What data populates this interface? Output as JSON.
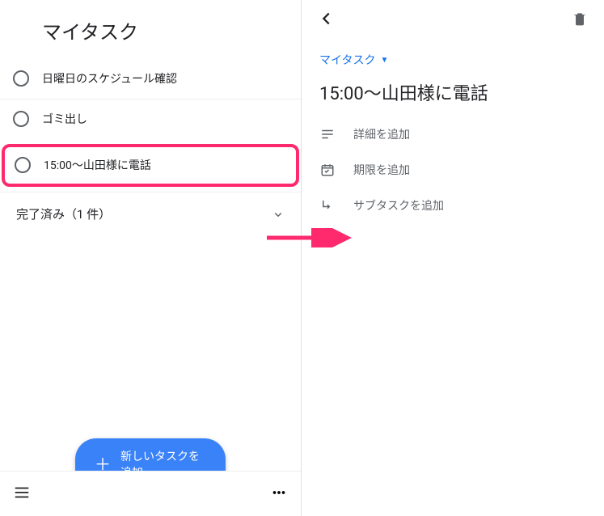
{
  "left": {
    "title": "マイタスク",
    "tasks": [
      {
        "label": "日曜日のスケジュール確認"
      },
      {
        "label": "ゴミ出し"
      },
      {
        "label": "15:00〜山田様に電話"
      }
    ],
    "completed_label": "完了済み（1 件）",
    "fab_label": "新しいタスクを追加"
  },
  "right": {
    "list_name": "マイタスク",
    "task_title": "15:00〜山田様に電話",
    "add_detail": "詳細を追加",
    "add_due": "期限を追加",
    "add_subtask": "サブタスクを追加"
  }
}
